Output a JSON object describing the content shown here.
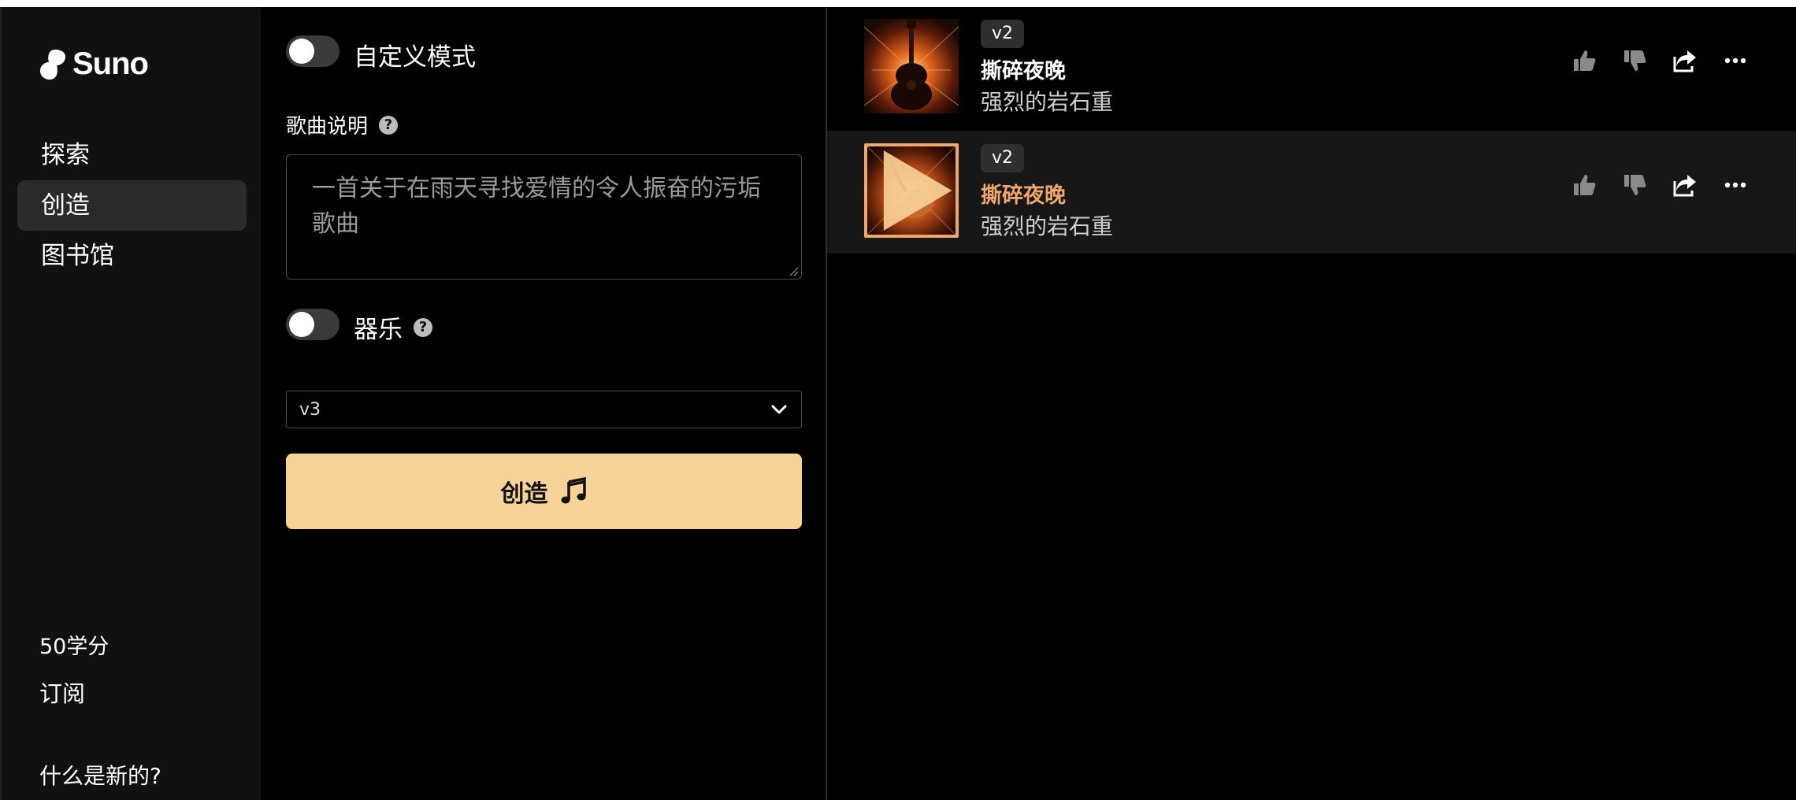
{
  "sidebar": {
    "logo_text": "Suno",
    "nav": [
      {
        "label": "探索"
      },
      {
        "label": "创造"
      },
      {
        "label": "图书馆"
      }
    ],
    "credits": "50学分",
    "subscribe": "订阅",
    "whats_new": "什么是新的?"
  },
  "create": {
    "custom_mode_label": "自定义模式",
    "song_description_label": "歌曲说明",
    "song_description_value": "一首关于在雨天寻找爱情的令人振奋的污垢歌曲",
    "instrumental_label": "器乐",
    "model_version": "v3",
    "create_button": "创造"
  },
  "songs": [
    {
      "version": "v2",
      "title": "撕碎夜晚",
      "style": "强烈的岩石重",
      "selected": false
    },
    {
      "version": "v2",
      "title": "撕碎夜晚",
      "style": "强烈的岩石重",
      "selected": true
    }
  ],
  "colors": {
    "accent_orange": "#f0a66a",
    "create_button_bg": "#f7d398",
    "sidebar_bg": "#111111"
  },
  "icons": [
    "suno-logo-icon",
    "help-icon",
    "chevron-down-icon",
    "music-note-icon",
    "thumbs-up-icon",
    "thumbs-down-icon",
    "share-icon",
    "more-icon",
    "play-icon"
  ]
}
